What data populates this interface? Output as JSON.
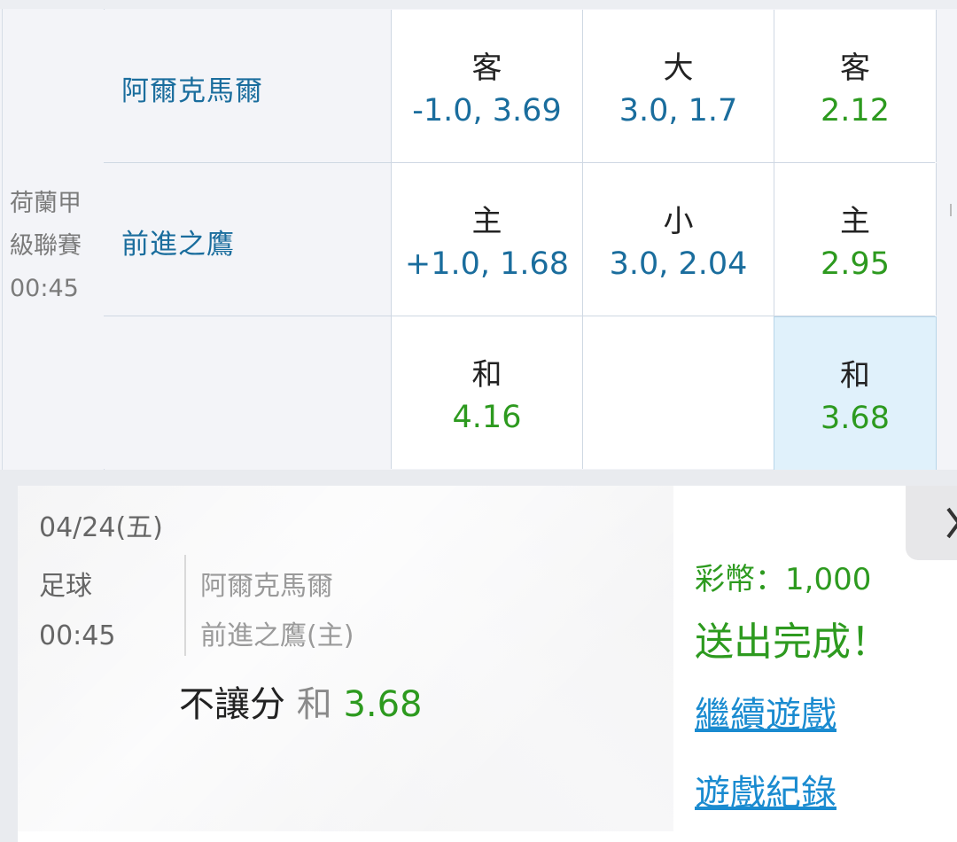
{
  "match": {
    "league_line1": "荷蘭甲",
    "league_line2": "級聯賽",
    "time": "00:45",
    "away_team": "阿爾克馬爾",
    "home_team": "前進之鷹"
  },
  "odds": {
    "row1": {
      "handicap": {
        "label": "客",
        "value": "-1.0, 3.69"
      },
      "total": {
        "label": "大",
        "value": "3.0, 1.7"
      },
      "moneyline": {
        "label": "客",
        "value": "2.12"
      }
    },
    "row2": {
      "handicap": {
        "label": "主",
        "value": "+1.0, 1.68"
      },
      "total": {
        "label": "小",
        "value": "3.0, 2.04"
      },
      "moneyline": {
        "label": "主",
        "value": "2.95"
      }
    },
    "row3": {
      "handicap": {
        "label": "和",
        "value": "4.16"
      },
      "moneyline": {
        "label": "和",
        "value": "3.68"
      }
    }
  },
  "ticket": {
    "date": "04/24(五)",
    "sport": "足球",
    "time": "00:45",
    "team_a": "阿爾克馬爾",
    "team_b": "前進之鷹(主)",
    "bet_type": "不讓分",
    "bet_pick": "和",
    "bet_odds": "3.68",
    "coins": "彩幣：1,000",
    "status": "送出完成！",
    "continue_label": "繼續遊戲",
    "history_label": "遊戲紀錄"
  },
  "colors": {
    "odds_blue": "#1a6d9d",
    "odds_green": "#2d9a1f",
    "selected_cell": "#e0f1fb",
    "link_blue": "#1a8bd0"
  },
  "icons": [
    "close-icon"
  ]
}
